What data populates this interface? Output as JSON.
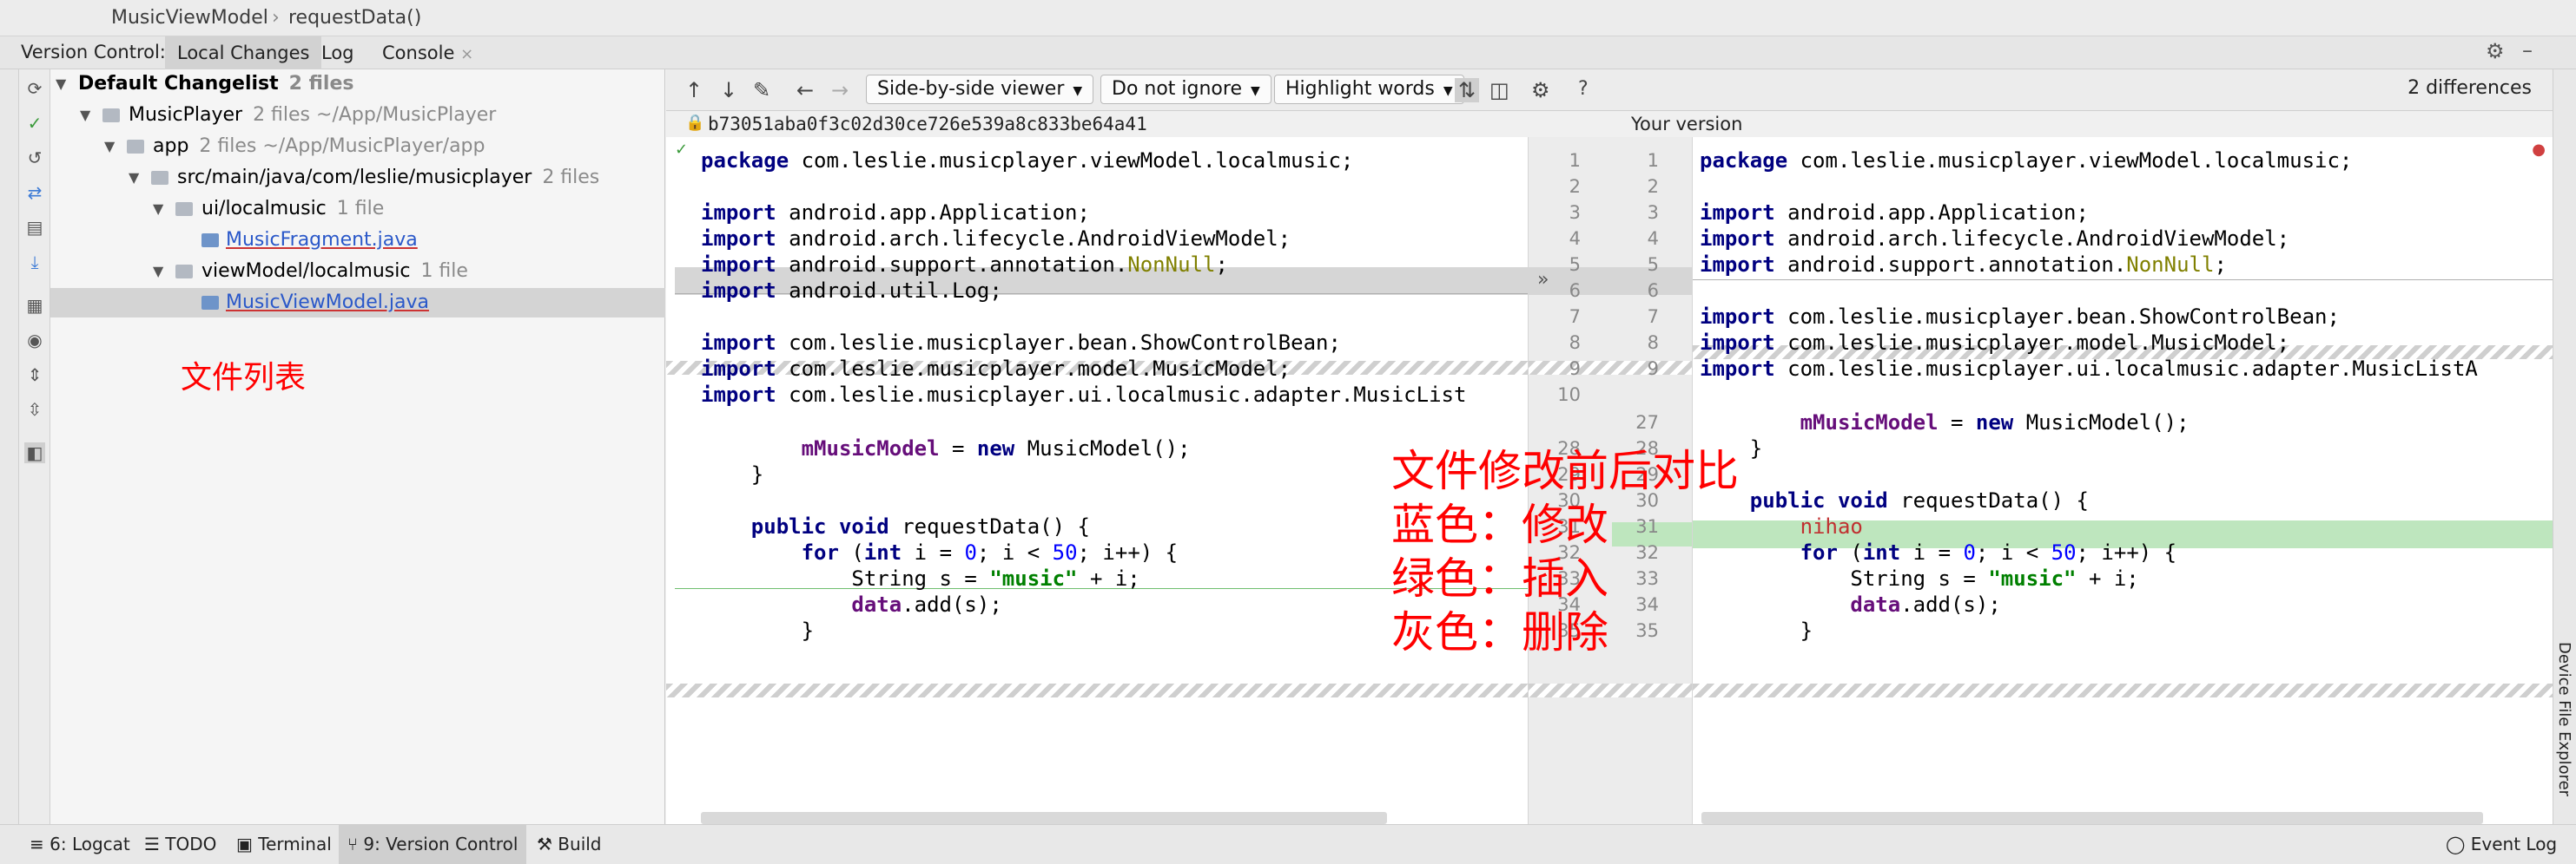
{
  "breadcrumb": {
    "file": "MusicViewModel",
    "sep": "›",
    "method": "requestData()"
  },
  "vc_header": {
    "label": "Version Control:",
    "tabs": [
      {
        "label": "Local Changes"
      },
      {
        "label": "Log"
      },
      {
        "label": "Console"
      }
    ],
    "close": "×",
    "gear": "⚙",
    "minimize": "–"
  },
  "tree": {
    "rows": [
      {
        "name": "Default Changelist",
        "meta": "2 files"
      },
      {
        "name": "MusicPlayer",
        "meta": "2 files  ~/App/MusicPlayer"
      },
      {
        "name": "app",
        "meta": "2 files  ~/App/MusicPlayer/app"
      },
      {
        "name": "src/main/java/com/leslie/musicplayer",
        "meta": "2 files"
      },
      {
        "name": "ui/localmusic",
        "meta": "1 file"
      },
      {
        "name": "MusicFragment.java",
        "meta": ""
      },
      {
        "name": "viewModel/localmusic",
        "meta": "1 file"
      },
      {
        "name": "MusicViewModel.java",
        "meta": ""
      }
    ]
  },
  "annotations": {
    "file_list": "文件列表",
    "lines": [
      "文件修改前后对比",
      "蓝色：修改",
      "绿色：插入",
      "灰色：删除"
    ]
  },
  "diff_toolbar": {
    "viewer": "Side-by-side viewer",
    "ignore": "Do not ignore",
    "highlight": "Highlight words",
    "help": "?",
    "count": "2 differences"
  },
  "hash_bar": {
    "hash": "b73051aba0f3c02d30ce726e539a8c833be64a41",
    "your_version": "Your version"
  },
  "gutter": {
    "left_numbers": [
      "1",
      "2",
      "3",
      "4",
      "5",
      "6",
      "7",
      "8",
      "9",
      "10",
      "",
      "28",
      "29",
      "30",
      "31",
      "32",
      "33",
      "34",
      "35"
    ],
    "right_numbers": [
      "1",
      "2",
      "3",
      "4",
      "5",
      "6",
      "7",
      "8",
      "9",
      "",
      "27",
      "28",
      "29",
      "30",
      "31",
      "32",
      "33",
      "34",
      "35"
    ]
  },
  "bottom_bar": {
    "tabs": [
      {
        "label": "6: Logcat"
      },
      {
        "label": "TODO"
      },
      {
        "label": "Terminal"
      },
      {
        "label": "9: Version Control"
      },
      {
        "label": "Build"
      }
    ],
    "event_log": "Event Log"
  },
  "right_strip": {
    "label": "Device File Explorer"
  },
  "colors": {
    "insert": "#bee6be",
    "delete": "#d6d6d6",
    "annotation": "#ff0000",
    "keyword": "#000080"
  }
}
